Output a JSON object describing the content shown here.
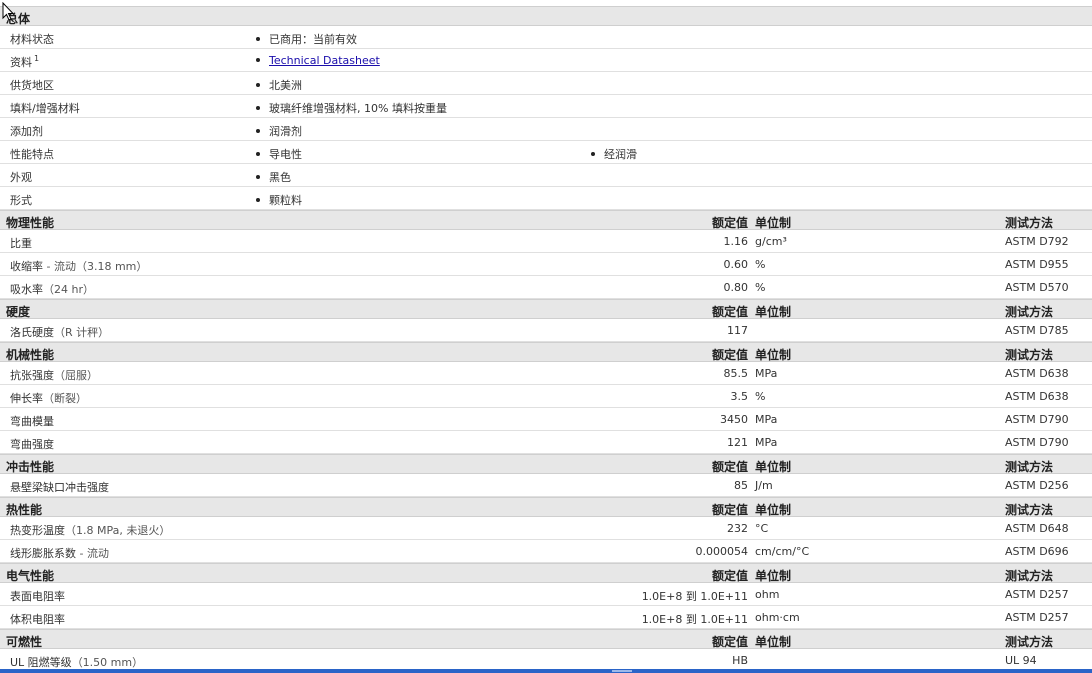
{
  "sections": [
    {
      "title": "总体",
      "type": "general",
      "rows": [
        {
          "label": "材料状态",
          "values": [
            "已商用：当前有效"
          ]
        },
        {
          "label": "资料",
          "sup": "1",
          "values": [
            "Technical Datasheet"
          ],
          "link": true
        },
        {
          "label": "供货地区",
          "values": [
            "北美洲"
          ]
        },
        {
          "label": "填料/增强材料",
          "values": [
            "玻璃纤维增强材料, 10% 填料按重量"
          ]
        },
        {
          "label": "添加剂",
          "values": [
            "润滑剂"
          ]
        },
        {
          "label": "性能特点",
          "values": [
            "导电性",
            "经润滑"
          ]
        },
        {
          "label": "外观",
          "values": [
            "黑色"
          ]
        },
        {
          "label": "形式",
          "values": [
            "颗粒料"
          ]
        }
      ]
    },
    {
      "title": "物理性能",
      "type": "property",
      "col_value": "额定值",
      "col_unit": "单位制",
      "col_method": "测试方法",
      "rows": [
        {
          "label": "比重",
          "sub": "",
          "value": "1.16",
          "unit": "g/cm³",
          "method": "ASTM D792"
        },
        {
          "label": "收缩率",
          "sub": " - 流动（3.18 mm）",
          "value": "0.60",
          "unit": "%",
          "method": "ASTM D955"
        },
        {
          "label": "吸水率",
          "sub": "（24 hr）",
          "value": "0.80",
          "unit": "%",
          "method": "ASTM D570"
        }
      ]
    },
    {
      "title": "硬度",
      "type": "property",
      "col_value": "额定值",
      "col_unit": "单位制",
      "col_method": "测试方法",
      "rows": [
        {
          "label": "洛氏硬度",
          "sub": "（R 计秤）",
          "value": "117",
          "unit": "",
          "method": "ASTM D785"
        }
      ]
    },
    {
      "title": "机械性能",
      "type": "property",
      "col_value": "额定值",
      "col_unit": "单位制",
      "col_method": "测试方法",
      "rows": [
        {
          "label": "抗张强度",
          "sub": "（屈服）",
          "value": "85.5",
          "unit": "MPa",
          "method": "ASTM D638"
        },
        {
          "label": "伸长率",
          "sub": "（断裂）",
          "value": "3.5",
          "unit": "%",
          "method": "ASTM D638"
        },
        {
          "label": "弯曲模量",
          "sub": "",
          "value": "3450",
          "unit": "MPa",
          "method": "ASTM D790"
        },
        {
          "label": "弯曲强度",
          "sub": "",
          "value": "121",
          "unit": "MPa",
          "method": "ASTM D790"
        }
      ]
    },
    {
      "title": "冲击性能",
      "type": "property",
      "col_value": "额定值",
      "col_unit": "单位制",
      "col_method": "测试方法",
      "rows": [
        {
          "label": "悬壁梁缺口冲击强度",
          "sub": "",
          "value": "85",
          "unit": "J/m",
          "method": "ASTM D256"
        }
      ]
    },
    {
      "title": "热性能",
      "type": "property",
      "col_value": "额定值",
      "col_unit": "单位制",
      "col_method": "测试方法",
      "rows": [
        {
          "label": "热变形温度",
          "sub": "（1.8 MPa, 未退火）",
          "value": "232",
          "unit": "°C",
          "method": "ASTM D648"
        },
        {
          "label": "线形膨胀系数",
          "sub": " - 流动",
          "value": "0.000054",
          "unit": "cm/cm/°C",
          "method": "ASTM D696"
        }
      ]
    },
    {
      "title": "电气性能",
      "type": "property",
      "col_value": "额定值",
      "col_unit": "单位制",
      "col_method": "测试方法",
      "rows": [
        {
          "label": "表面电阻率",
          "sub": "",
          "value": "1.0E+8 到  1.0E+11",
          "unit": "ohm",
          "method": "ASTM D257"
        },
        {
          "label": "体积电阻率",
          "sub": "",
          "value": "1.0E+8 到  1.0E+11",
          "unit": "ohm·cm",
          "method": "ASTM D257"
        }
      ]
    },
    {
      "title": "可燃性",
      "type": "property",
      "col_value": "额定值",
      "col_unit": "单位制",
      "col_method": "测试方法",
      "rows": [
        {
          "label": "UL 阻燃等级",
          "sub": "（1.50 mm）",
          "value": "HB",
          "unit": "",
          "method": "UL 94"
        }
      ]
    }
  ]
}
